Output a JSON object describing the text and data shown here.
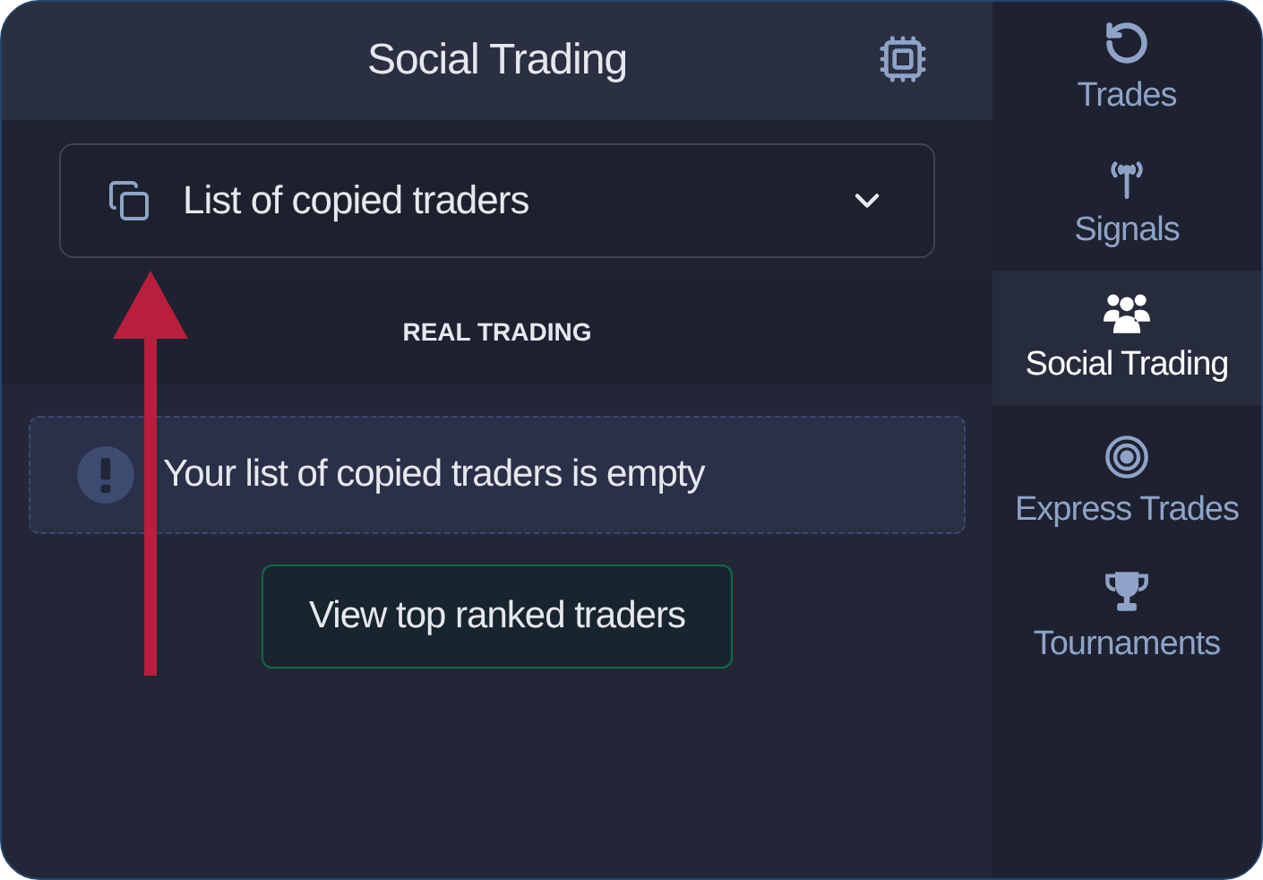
{
  "header": {
    "title": "Social Trading"
  },
  "dropdown": {
    "label": "List of copied traders"
  },
  "section_label": "REAL TRADING",
  "notice": {
    "text": "Your list of copied traders is empty"
  },
  "action_button": "View top ranked traders",
  "sidebar": {
    "items": [
      {
        "kind": "history",
        "label": "Trades",
        "selected": false
      },
      {
        "kind": "signal",
        "label": "Signals",
        "selected": false
      },
      {
        "kind": "people",
        "label": "Social Trading",
        "selected": true
      },
      {
        "kind": "target",
        "label": "Express Trades",
        "selected": false
      },
      {
        "kind": "trophy",
        "label": "Tournaments",
        "selected": false
      }
    ]
  }
}
